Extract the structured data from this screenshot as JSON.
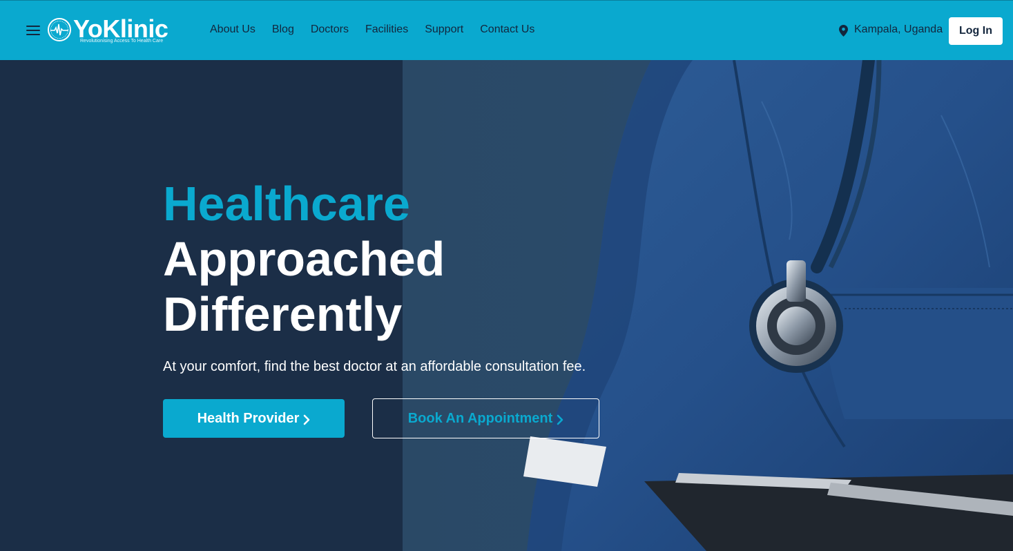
{
  "header": {
    "logo": {
      "name": "YoKlinic",
      "tagline": "Revolutionising Access To Health Care"
    },
    "nav": [
      "About Us",
      "Blog",
      "Doctors",
      "Facilities",
      "Support",
      "Contact Us"
    ],
    "location": "Kampala, Uganda",
    "login_label": "Log In"
  },
  "hero": {
    "title_line1": "Healthcare",
    "title_line2": "Approached",
    "title_line3": "Differently",
    "subtitle": "At your comfort, find the best doctor at an affordable consultation fee.",
    "primary_button": "Health Provider",
    "secondary_button": "Book An Appointment"
  },
  "colors": {
    "accent": "#0aa9cf",
    "navy": "#1b2e47",
    "dark_text": "#13263d",
    "white": "#ffffff"
  },
  "icons": {
    "menu": "hamburger-menu-icon",
    "location": "location-pin-icon",
    "chevron": "chevron-right-icon"
  }
}
